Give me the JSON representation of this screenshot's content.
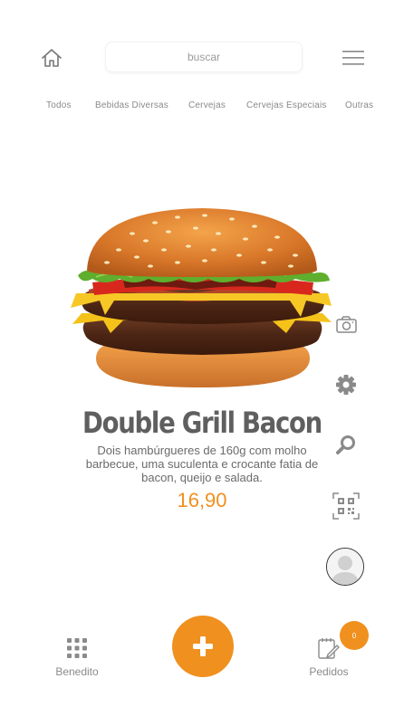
{
  "header": {
    "home_icon": "home-icon",
    "search": {
      "placeholder": "buscar",
      "value": ""
    },
    "menu_icon": "hamburger-menu-icon"
  },
  "categories": [
    {
      "label": "Todos"
    },
    {
      "label": "Bebidas Diversas"
    },
    {
      "label": "Cervejas"
    },
    {
      "label": "Cervejas Especiais"
    },
    {
      "label": "Outras"
    }
  ],
  "product": {
    "name": "Double Grill Bacon",
    "description": "Dois hambúrgueres de 160g com molho barbecue, uma suculenta e crocante fatia de bacon, queijo e salada.",
    "price": "16,90",
    "image": "double-burger-image"
  },
  "side_actions": [
    {
      "icon": "camera-icon"
    },
    {
      "icon": "gear-icon"
    },
    {
      "icon": "search-icon"
    },
    {
      "icon": "qr-code-icon"
    },
    {
      "icon": "avatar-icon"
    }
  ],
  "bottom_nav": {
    "left": {
      "label": "Benedito",
      "icon": "grid-icon"
    },
    "center": {
      "icon": "plus-icon"
    },
    "right": {
      "label": "Pedidos",
      "icon": "orders-icon",
      "badge": "0"
    }
  },
  "colors": {
    "accent": "#f0901e",
    "text": "#5f5f5f",
    "muted": "#8a8a8a"
  }
}
